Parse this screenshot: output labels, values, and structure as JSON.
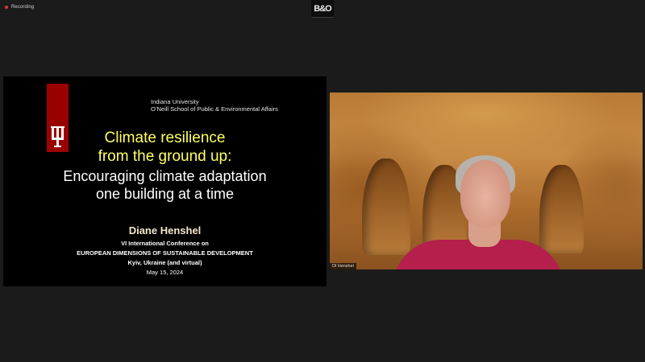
{
  "recording": {
    "label": "Recording"
  },
  "app_logo": {
    "text": "B&O"
  },
  "slide": {
    "institution_line1": "Indiana University",
    "institution_line2": "O’Neill School of Public & Environmental Affairs",
    "title_line1": "Climate resilience",
    "title_line2": "from the ground up:",
    "subtitle_line1": "Encouraging climate adaptation",
    "subtitle_line2": "one building at a time",
    "speaker": "Diane Henshel",
    "conference_line1": "VI International Conference on",
    "conference_line2": "EUROPEAN DIMENSIONS OF SUSTAINABLE DEVELOPMENT",
    "location": "Kyiv, Ukraine (and virtual)",
    "date": "May 15, 2024"
  },
  "video": {
    "participant_name": "Dl Henshel"
  },
  "colors": {
    "slide_title": "#ffff66",
    "iu_crimson": "#990000",
    "recording_dot": "#e0353a"
  }
}
